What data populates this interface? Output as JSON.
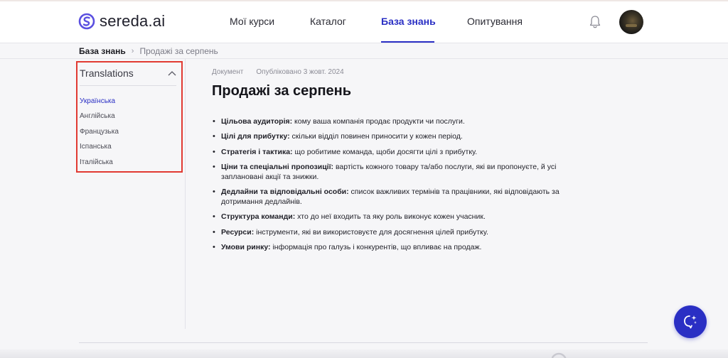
{
  "header": {
    "logo_text": "sereda.ai",
    "nav": [
      {
        "label": "Мої курси"
      },
      {
        "label": "Каталог"
      },
      {
        "label": "База знань",
        "active": true
      },
      {
        "label": "Опитування"
      }
    ],
    "icons": {
      "notifications": "bell-icon",
      "profile": "avatar"
    }
  },
  "breadcrumb": {
    "root": "База знань",
    "separator": "›",
    "current": "Продажі за серпень"
  },
  "translations": {
    "title": "Translations",
    "items": [
      {
        "label": "Українська",
        "active": true
      },
      {
        "label": "Англійська"
      },
      {
        "label": "Французька"
      },
      {
        "label": "Іспанська"
      },
      {
        "label": "Італійська"
      }
    ]
  },
  "document": {
    "type": "Документ",
    "published": "Опубліковано 3 жовт. 2024",
    "title": "Продажі за серпень",
    "items": [
      {
        "term": "Цільова аудиторія:",
        "text": " кому ваша компанія продає продукти чи послуги."
      },
      {
        "term": "Цілі для прибутку:",
        "text": " скільки відділ повинен приносити у кожен період."
      },
      {
        "term": "Стратегія і тактика:",
        "text": " що робитиме команда, щоби досягти цілі з прибутку."
      },
      {
        "term": "Ціни та спеціальні пропозиції:",
        "text": " вартість кожного товару та/або послуги, які ви пропонуєте, й усі заплановані акції та знижки."
      },
      {
        "term": "Дедлайни та відповідальні особи:",
        "text": " список важливих термінів та працівники, які відповідають за дотримання дедлайнів."
      },
      {
        "term": "Структура команди:",
        "text": " хто до неї входить та яку роль виконує кожен учасник."
      },
      {
        "term": "Ресурси:",
        "text": " інструменти, які ви використовуєте для досягнення цілей прибутку."
      },
      {
        "term": "Умови ринку:",
        "text": " інформація про галузь і конкурентів, що впливає на продаж."
      }
    ]
  },
  "colors": {
    "accent": "#2a2fc4",
    "highlight_border": "#e13a32"
  },
  "fab": {
    "icon": "ai-assistant-icon"
  }
}
